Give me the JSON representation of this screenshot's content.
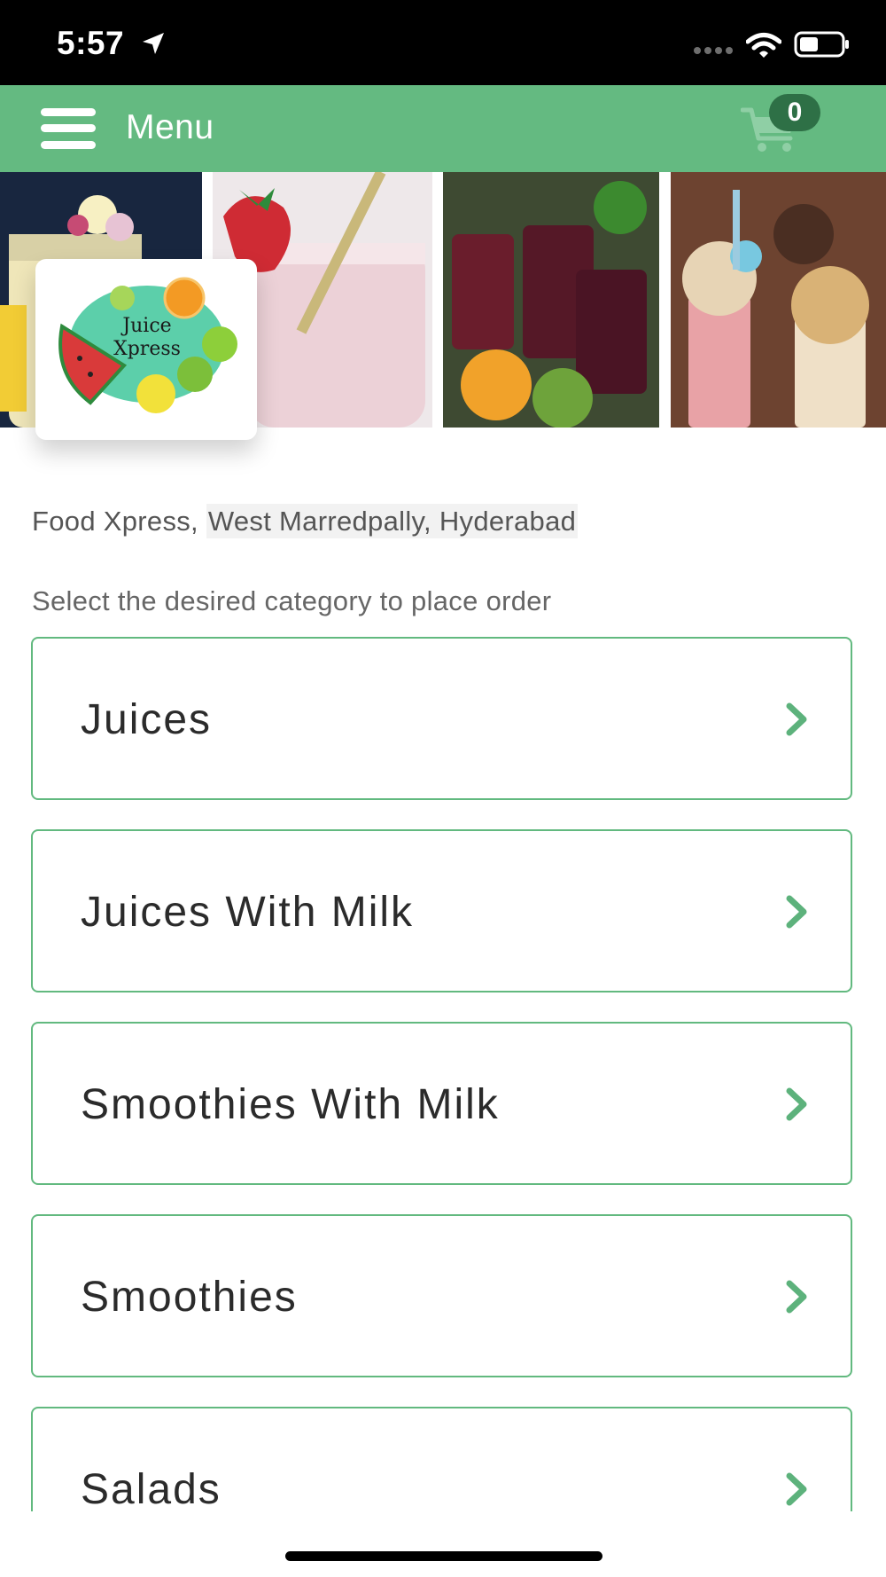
{
  "status_bar": {
    "time": "5:57"
  },
  "header": {
    "title": "Menu",
    "cart_count": "0",
    "brand_color": "#64ba81"
  },
  "logo": {
    "line1": "Juice",
    "line2": "Xpress"
  },
  "store": {
    "name": "Food Xpress, ",
    "location": "West Marredpally, Hyderabad"
  },
  "instruction": "Select the desired category to place order",
  "categories": [
    {
      "label": "Juices"
    },
    {
      "label": "Juices With Milk"
    },
    {
      "label": "Smoothies With Milk"
    },
    {
      "label": "Smoothies"
    },
    {
      "label": "Salads"
    }
  ],
  "icons": {
    "menu": "hamburger-icon",
    "cart": "cart-icon",
    "category_arrow": "chevron-right-icon"
  }
}
